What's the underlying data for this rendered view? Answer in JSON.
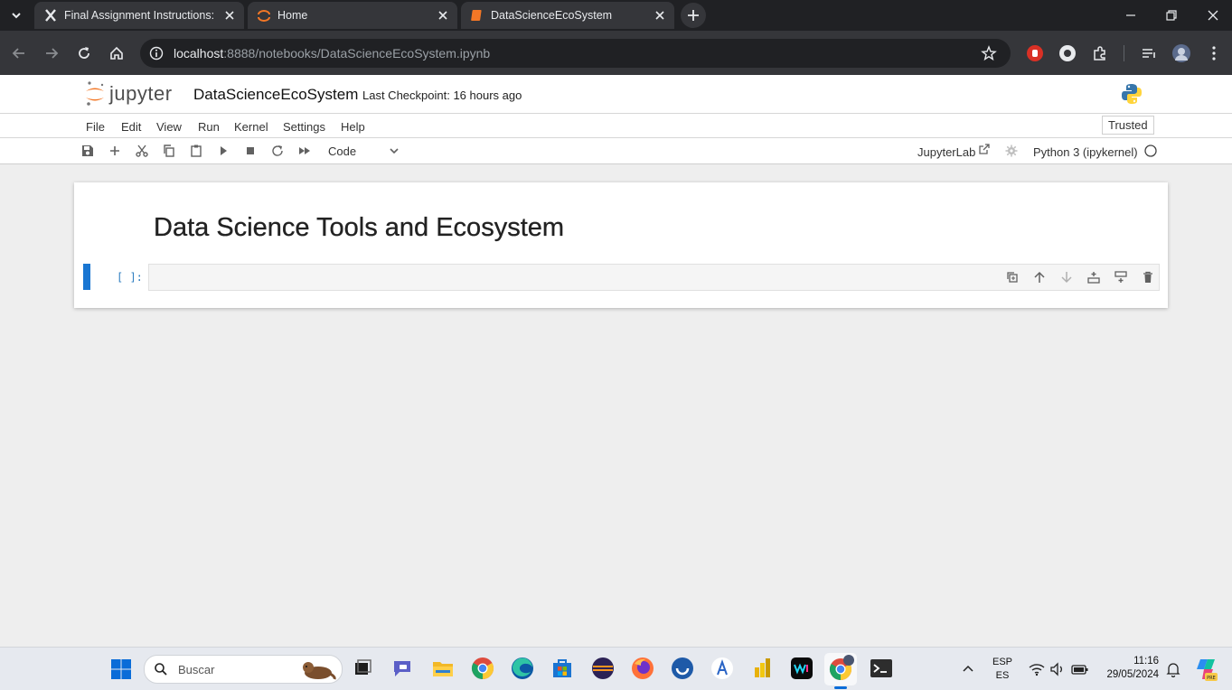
{
  "browser": {
    "tabs": [
      {
        "title": "Final Assignment Instructions: C"
      },
      {
        "title": "Home"
      },
      {
        "title": "DataScienceEcoSystem"
      }
    ],
    "address": {
      "host": "localhost",
      "path": ":8888/notebooks/DataScienceEcoSystem.ipynb"
    }
  },
  "jupyter": {
    "logo_text": "jupyter",
    "notebook_name": "DataScienceEcoSystem",
    "checkpoint": "Last Checkpoint: 16 hours ago",
    "trusted": "Trusted",
    "menu": [
      "File",
      "Edit",
      "View",
      "Run",
      "Kernel",
      "Settings",
      "Help"
    ],
    "cell_type": "Code",
    "jupyterlab_link": "JupyterLab",
    "kernel_name": "Python 3 (ipykernel)"
  },
  "notebook": {
    "heading": "Data Science Tools and Ecosystem",
    "prompt": "[ ]:"
  },
  "taskbar": {
    "search_placeholder": "Buscar",
    "lang_top": "ESP",
    "lang_bottom": "ES",
    "time": "11:16",
    "date": "29/05/2024"
  },
  "colors": {
    "jupyter_orange": "#f37726",
    "active_cell": "#1976d2"
  }
}
